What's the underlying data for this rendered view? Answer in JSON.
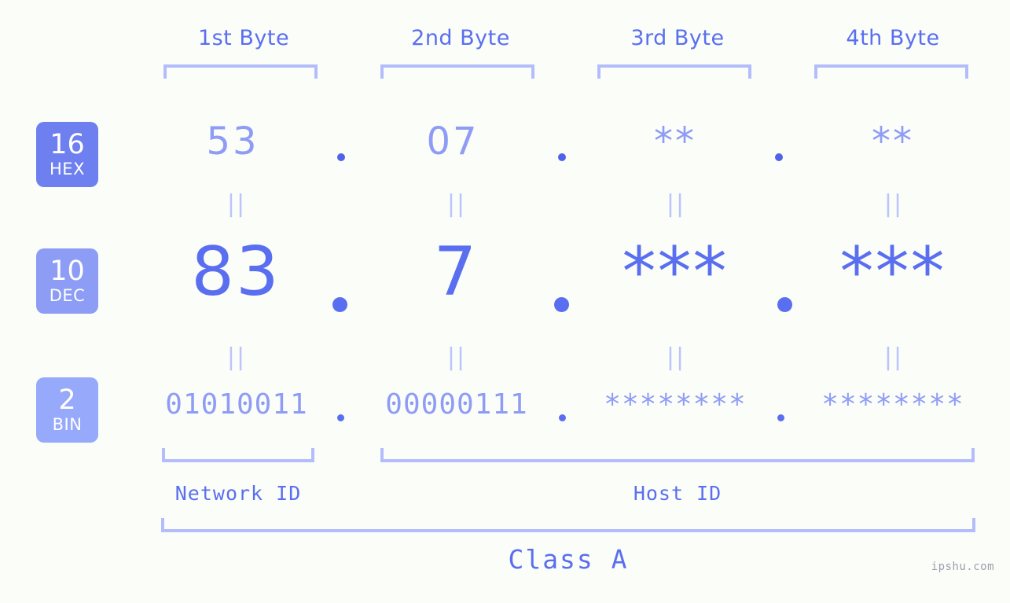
{
  "meta": {
    "watermark": "ipshu.com",
    "accent_strong": "#5a6ff0",
    "accent_mid": "#8e9cf6",
    "accent_light": "#b4bdfb",
    "background": "#fbfdf8"
  },
  "byte_headers": [
    {
      "label": "1st Byte"
    },
    {
      "label": "2nd Byte"
    },
    {
      "label": "3rd Byte"
    },
    {
      "label": "4th Byte"
    }
  ],
  "bases": [
    {
      "id": "hex",
      "number": "16",
      "name": "HEX",
      "color": "#6e7ff0"
    },
    {
      "id": "dec",
      "number": "10",
      "name": "DEC",
      "color": "#8d9cf5"
    },
    {
      "id": "bin",
      "number": "2",
      "name": "BIN",
      "color": "#96a9fa"
    }
  ],
  "rows": {
    "hex": {
      "values": [
        "53",
        "07",
        "**",
        "**"
      ],
      "separator": "."
    },
    "dec": {
      "values": [
        "83",
        "7",
        "***",
        "***"
      ],
      "separator": "."
    },
    "bin": {
      "values": [
        "01010011",
        "00000111",
        "********",
        "********"
      ],
      "separator": "."
    }
  },
  "equals_marks": {
    "hex_to_dec": [
      "||",
      "||",
      "||",
      "||"
    ],
    "dec_to_bin": [
      "||",
      "||",
      "||",
      "||"
    ]
  },
  "id_sections": [
    {
      "label": "Network ID"
    },
    {
      "label": "Host ID"
    }
  ],
  "class": {
    "label": "Class A"
  }
}
